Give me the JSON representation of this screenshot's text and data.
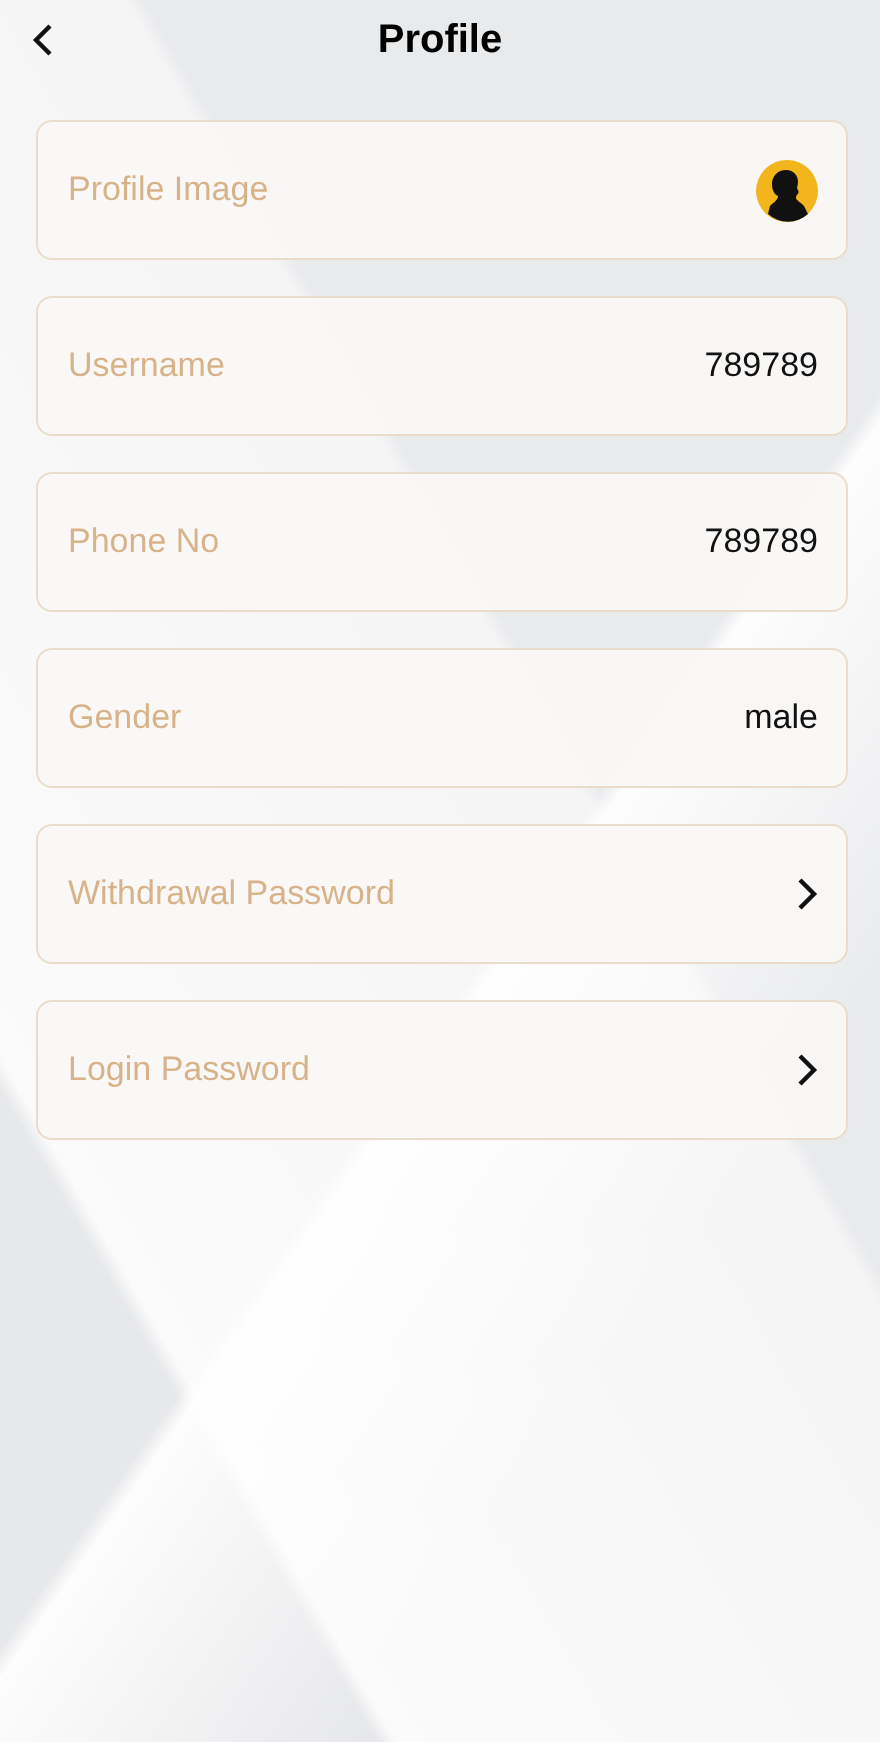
{
  "header": {
    "title": "Profile"
  },
  "rows": [
    {
      "label": "Profile Image",
      "kind": "avatar"
    },
    {
      "label": "Username",
      "kind": "value",
      "value": "789789"
    },
    {
      "label": "Phone No",
      "kind": "value",
      "value": "789789"
    },
    {
      "label": "Gender",
      "kind": "value",
      "value": "male"
    },
    {
      "label": "Withdrawal Password",
      "kind": "link"
    },
    {
      "label": "Login Password",
      "kind": "link"
    }
  ]
}
